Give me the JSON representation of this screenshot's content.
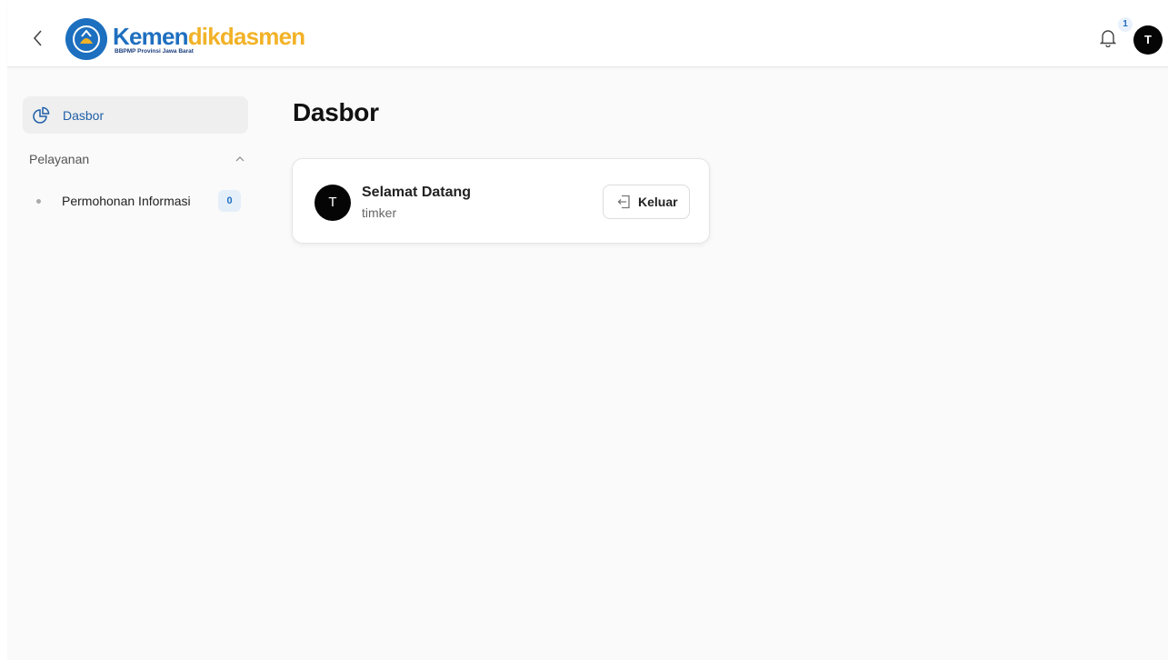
{
  "header": {
    "logo_part1": "Kemen",
    "logo_part2": "dikdasmen",
    "logo_subtitle": "BBPMP Provinsi Jawa Barat",
    "notification_count": "1",
    "avatar_initial": "T",
    "icons": {
      "back": "chevron-left-icon",
      "bell": "bell-icon"
    }
  },
  "sidebar": {
    "dasbor_label": "Dasbor",
    "section_label": "Pelayanan",
    "items": [
      {
        "label": "Permohonan Informasi",
        "count": "0"
      }
    ],
    "icons": {
      "dasbor": "pie-chart-icon",
      "section": "chevron-up-icon"
    }
  },
  "main": {
    "title": "Dasbor",
    "card": {
      "avatar_initial": "T",
      "greeting": "Selamat Datang",
      "username": "timker",
      "logout_label": "Keluar",
      "logout_icon": "logout-icon"
    }
  },
  "colors": {
    "brand_blue": "#1f6fbf",
    "brand_yellow": "#f2b227",
    "background": "#fafafa"
  }
}
